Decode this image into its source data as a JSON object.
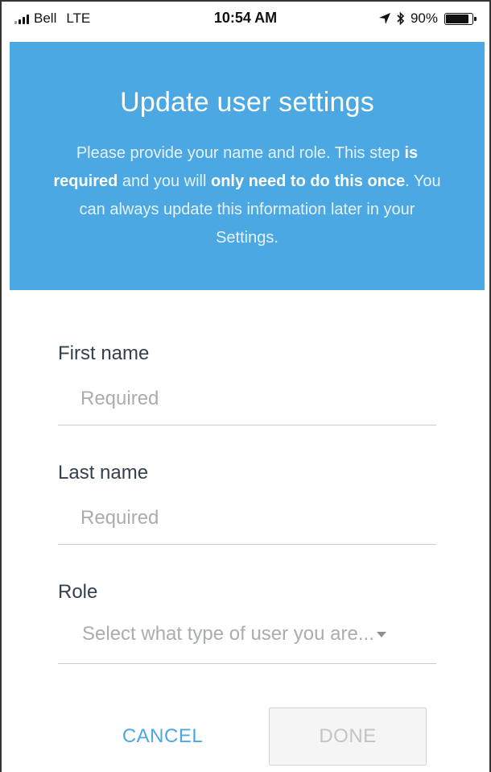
{
  "status_bar": {
    "carrier": "Bell",
    "network": "LTE",
    "time": "10:54 AM",
    "battery_percent": "90%",
    "battery_level": 0.9,
    "icons": [
      "signal-icon",
      "location-arrow-icon",
      "bluetooth-icon",
      "battery-icon"
    ]
  },
  "header": {
    "title": "Update user settings",
    "description_parts": [
      "Please provide your name and role. This step ",
      "is required",
      " and you will ",
      "only need to do this once",
      ". You can always update this information later in your Settings."
    ],
    "background_color": "#4ba8e3"
  },
  "form": {
    "first_name": {
      "label": "First name",
      "placeholder": "Required",
      "value": ""
    },
    "last_name": {
      "label": "Last name",
      "placeholder": "Required",
      "value": ""
    },
    "role": {
      "label": "Role",
      "selected": "Select what type of user you are..."
    }
  },
  "actions": {
    "cancel_label": "CANCEL",
    "done_label": "DONE",
    "accent_color": "#4ba8e3"
  }
}
